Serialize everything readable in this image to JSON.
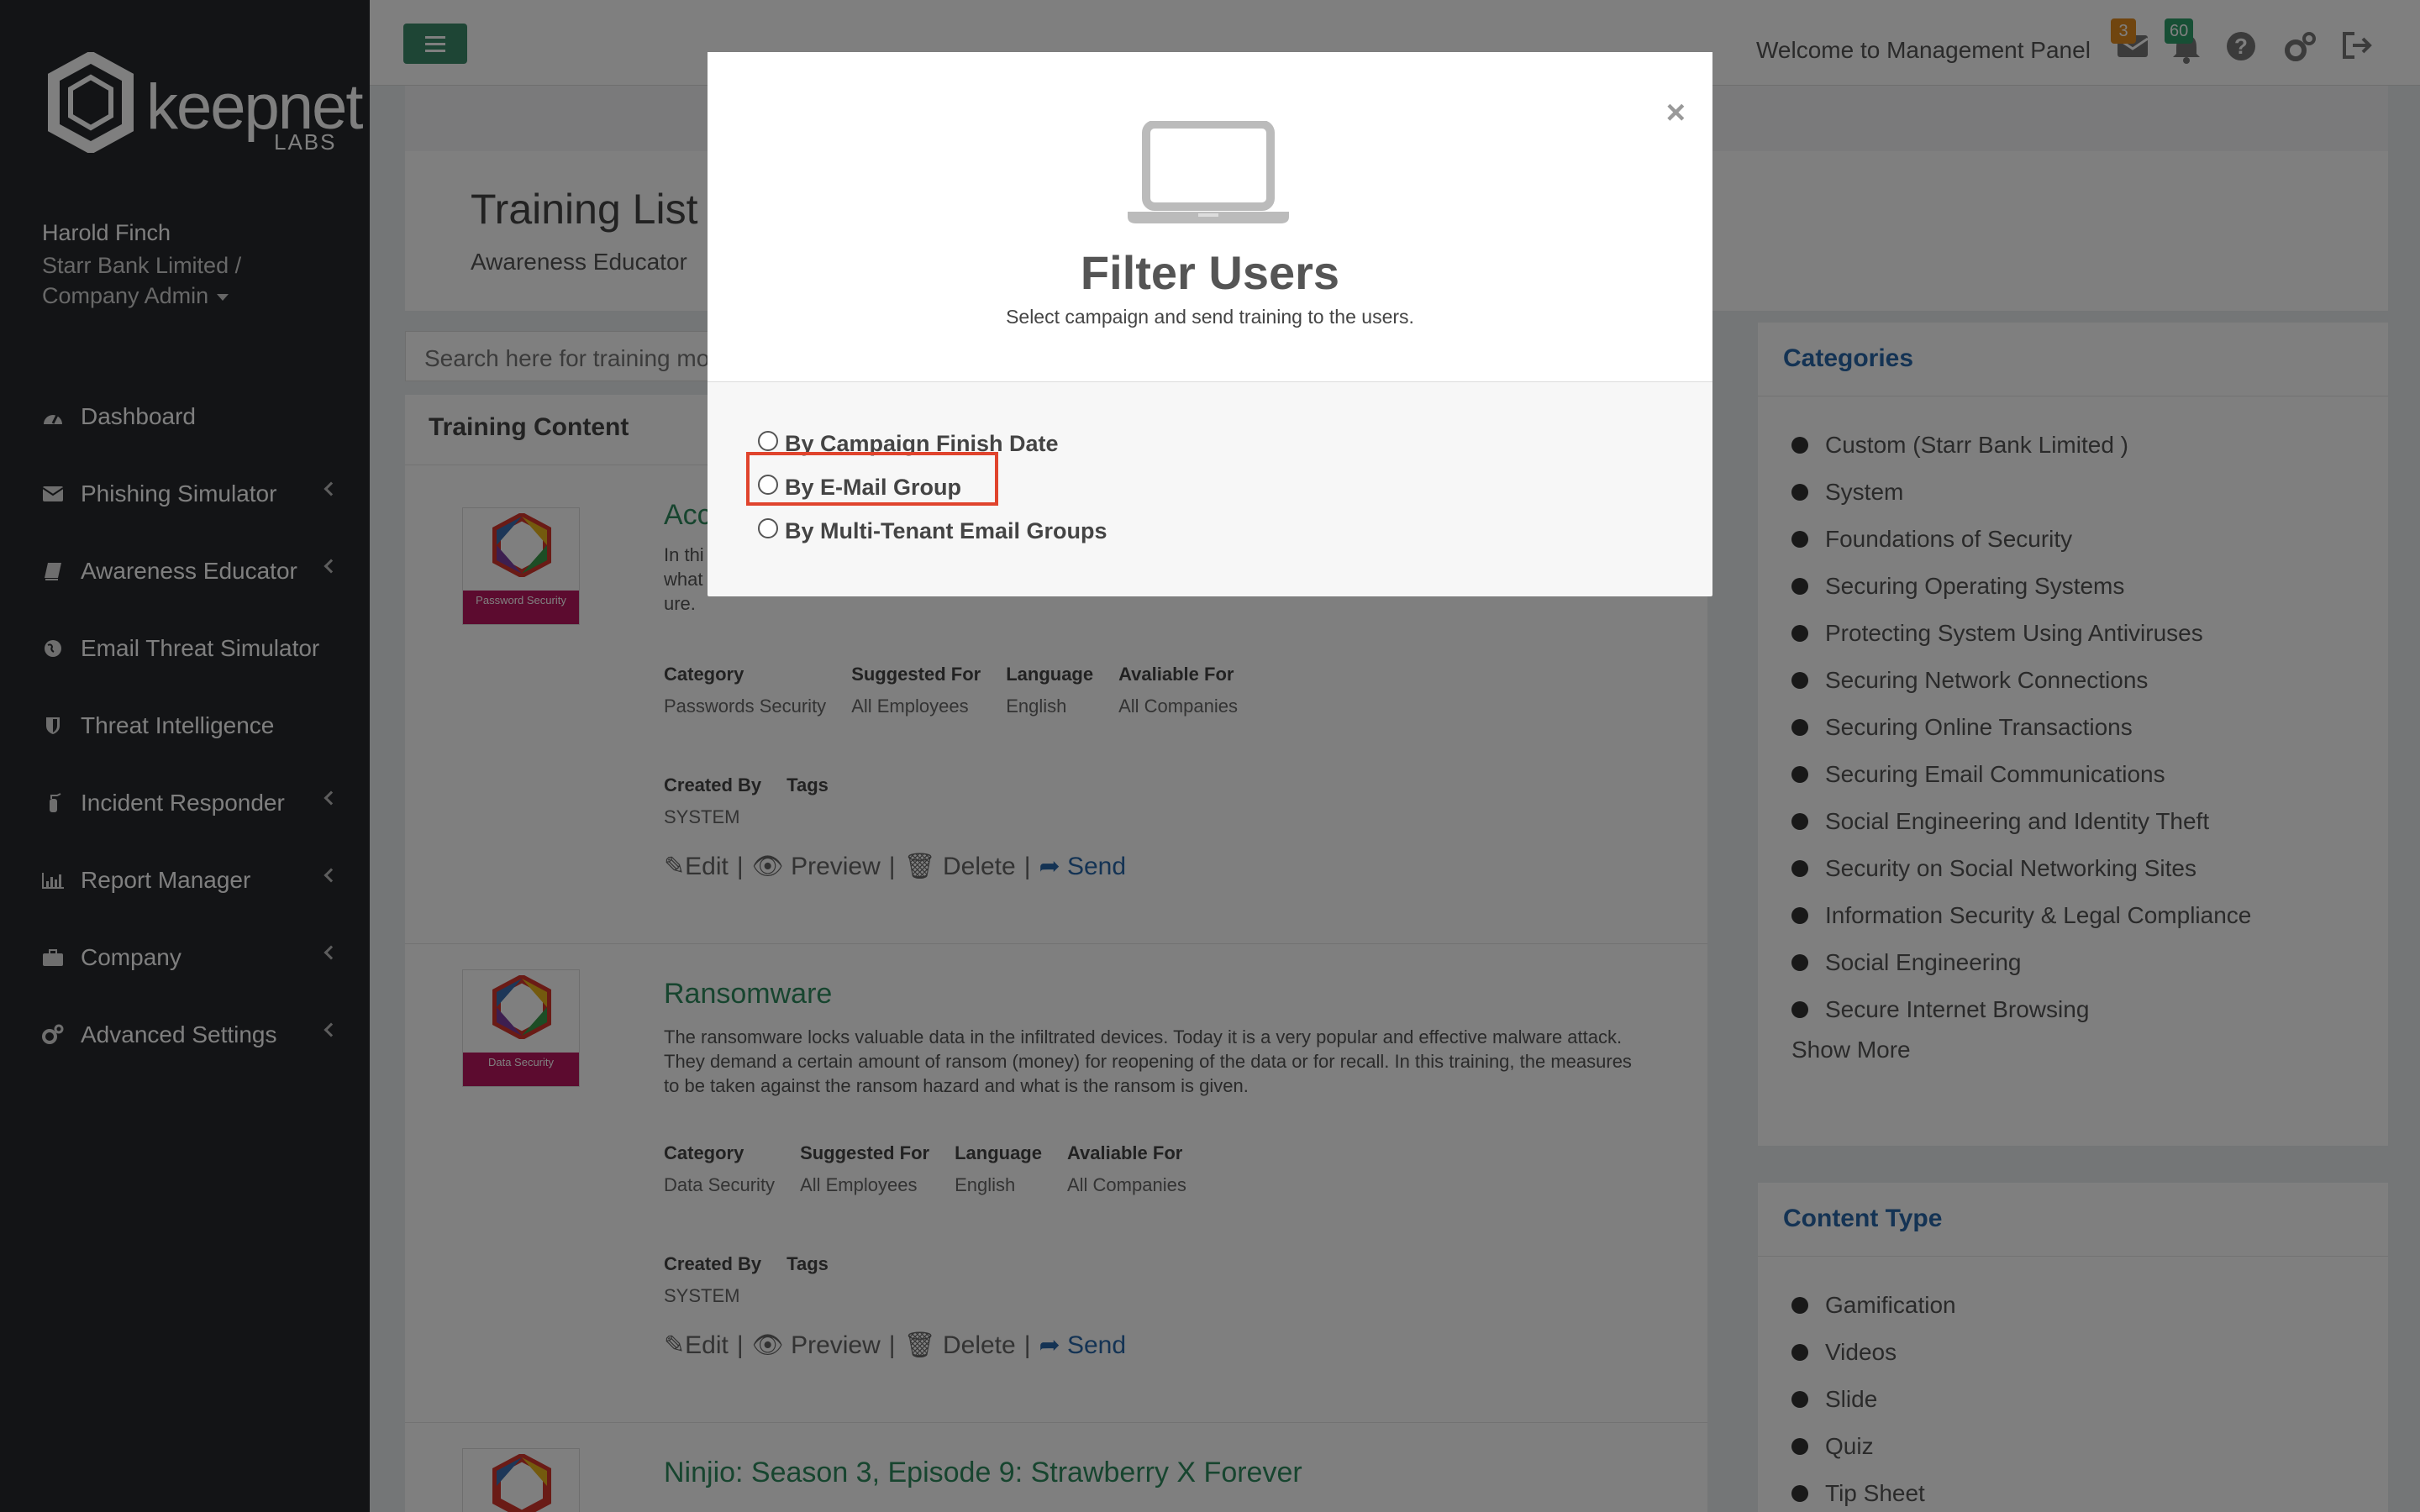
{
  "brand": {
    "logo_text": "keepnet",
    "logo_sub": "LABS"
  },
  "user": {
    "name": "Harold Finch",
    "org": "Starr Bank Limited / Company Admin"
  },
  "nav": [
    {
      "label": "Dashboard",
      "icon": "dashboard-icon",
      "has_children": false
    },
    {
      "label": "Phishing Simulator",
      "icon": "envelope-icon",
      "has_children": true
    },
    {
      "label": "Awareness Educator",
      "icon": "book-icon",
      "has_children": true
    },
    {
      "label": "Email Threat Simulator",
      "icon": "globe-icon",
      "has_children": false
    },
    {
      "label": "Threat Intelligence",
      "icon": "shield-icon",
      "has_children": false
    },
    {
      "label": "Incident Responder",
      "icon": "fire-extinguisher-icon",
      "has_children": true
    },
    {
      "label": "Report Manager",
      "icon": "bar-chart-icon",
      "has_children": true
    },
    {
      "label": "Company",
      "icon": "briefcase-icon",
      "has_children": true
    },
    {
      "label": "Advanced Settings",
      "icon": "cogs-icon",
      "has_children": true
    }
  ],
  "topbar": {
    "welcome": "Welcome to Management Panel",
    "mail_badge": "3",
    "bell_badge": "60"
  },
  "page": {
    "title": "Training List",
    "breadcrumb": "Awareness Educator",
    "breadcrumb_sep": "/"
  },
  "search": {
    "placeholder": "Search here for training mo"
  },
  "main": {
    "panel_title": "Training Content"
  },
  "labels": {
    "category": "Category",
    "suggested_for": "Suggested For",
    "language": "Language",
    "available_for": "Avaliable For",
    "created_by": "Created By",
    "tags": "Tags",
    "edit": "Edit",
    "preview": "Preview",
    "delete": "Delete",
    "send": "Send",
    "sep": "|"
  },
  "courses": [
    {
      "title": "Acc",
      "thumb_label": "Password Security",
      "description": "In thi\nwhat\nure.",
      "category": "Passwords Security",
      "suggested_for": "All Employees",
      "language": "English",
      "available_for": "All Companies",
      "created_by": "SYSTEM"
    },
    {
      "title": "Ransomware",
      "thumb_label": "Data Security",
      "description": "The ransomware locks valuable data in the infiltrated devices. Today it is a very popular and effective malware attack. They demand a certain amount of ransom (money) for reopening of the data or for recall. In this training, the measures to be taken against the ransom hazard and what is the ransom is given.",
      "category": "Data Security",
      "suggested_for": "All Employees",
      "language": "English",
      "available_for": "All Companies",
      "created_by": "SYSTEM"
    },
    {
      "title": "Ninjio: Season 3, Episode 9: Strawberry X Forever"
    }
  ],
  "categories": {
    "title": "Categories",
    "items": [
      "Custom (Starr Bank Limited )",
      "System",
      "Foundations of Security",
      "Securing Operating Systems",
      "Protecting System Using Antiviruses",
      "Securing Network Connections",
      "Securing Online Transactions",
      "Securing Email Communications",
      "Social Engineering and Identity Theft",
      "Security on Social Networking Sites",
      "Information Security & Legal Compliance",
      "Social Engineering",
      "Secure Internet Browsing"
    ],
    "show_more": "Show More"
  },
  "content_type": {
    "title": "Content Type",
    "items": [
      "Gamification",
      "Videos",
      "Slide",
      "Quiz",
      "Tip Sheet"
    ]
  },
  "modal": {
    "title": "Filter Users",
    "subtitle": "Select campaign and send training to the users.",
    "close": "×",
    "options": [
      "By Campaign Finish Date",
      "By E-Mail Group",
      "By Multi-Tenant Email Groups"
    ],
    "highlighted_option": "By E-Mail Group"
  },
  "colors": {
    "sidebar_bg": "#26292c",
    "accent_green": "#3d8a6b",
    "title_green": "#2e8a5e",
    "link_blue": "#2867a8",
    "badge_orange": "#e08a1e",
    "badge_green": "#2e9e6b",
    "highlight_red": "#e0442d"
  }
}
